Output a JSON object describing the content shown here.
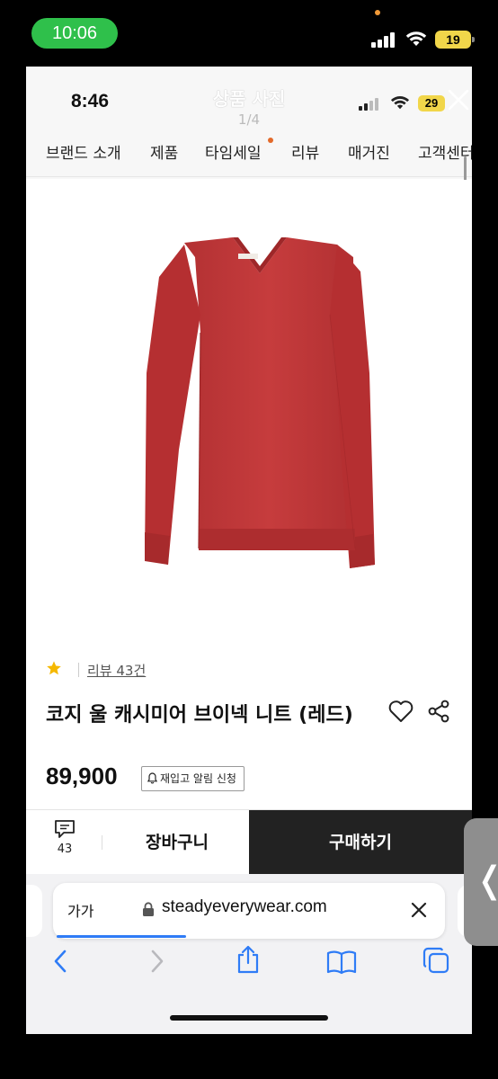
{
  "outer_status": {
    "time": "10:06",
    "battery": "19"
  },
  "viewer": {
    "inner_time": "8:46",
    "title": "상품 사진",
    "counter": "1/4",
    "battery": "29"
  },
  "nav": {
    "items": [
      {
        "label": "브랜드 소개"
      },
      {
        "label": "제품"
      },
      {
        "label": "타임세일"
      },
      {
        "label": "리뷰"
      },
      {
        "label": "매거진"
      },
      {
        "label": "고객센터"
      }
    ],
    "dot_color": "#e36a2a"
  },
  "product": {
    "image": "red-v-neck-sweater",
    "sweater_color": "#c0393a",
    "review_link": "리뷰 43건",
    "name": "코지 울 캐시미어 브이넥 니트 (레드)",
    "price": "89,900",
    "restock_label": "재입고 알림 신청"
  },
  "action_bar": {
    "comment_count": "43",
    "cart_label": "장바구니",
    "buy_label": "구매하기"
  },
  "safari": {
    "aa_label": "가가",
    "url": "steadyeverywear.com",
    "accent": "#2f7cf6"
  },
  "side_handle": {
    "glyph": "❬"
  }
}
